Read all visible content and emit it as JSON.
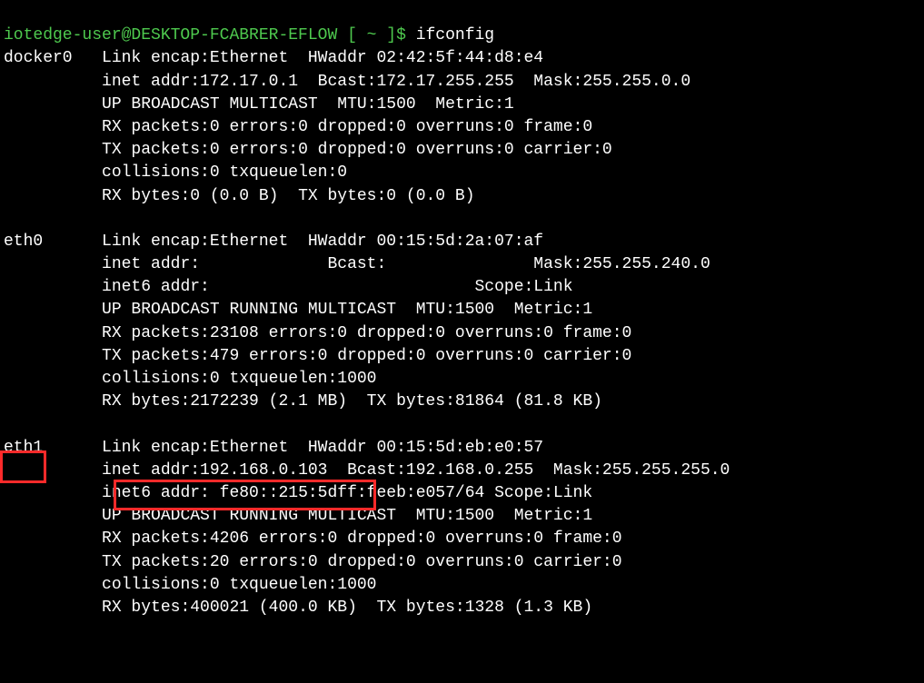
{
  "prompt": {
    "user_host": "iotedge-user@DESKTOP-FCABRER-EFLOW",
    "path_segment": " [ ~ ]$ ",
    "command": "ifconfig"
  },
  "interfaces": {
    "docker0": {
      "name": "docker0",
      "l1": "Link encap:Ethernet  HWaddr 02:42:5f:44:d8:e4",
      "l2": "inet addr:172.17.0.1  Bcast:172.17.255.255  Mask:255.255.0.0",
      "l3": "UP BROADCAST MULTICAST  MTU:1500  Metric:1",
      "l4": "RX packets:0 errors:0 dropped:0 overruns:0 frame:0",
      "l5": "TX packets:0 errors:0 dropped:0 overruns:0 carrier:0",
      "l6": "collisions:0 txqueuelen:0",
      "l7": "RX bytes:0 (0.0 B)  TX bytes:0 (0.0 B)"
    },
    "eth0": {
      "name": "eth0",
      "l1": "Link encap:Ethernet  HWaddr 00:15:5d:2a:07:af",
      "l2": "inet addr:             Bcast:               Mask:255.255.240.0",
      "l3": "inet6 addr:                           Scope:Link",
      "l4": "UP BROADCAST RUNNING MULTICAST  MTU:1500  Metric:1",
      "l5": "RX packets:23108 errors:0 dropped:0 overruns:0 frame:0",
      "l6": "TX packets:479 errors:0 dropped:0 overruns:0 carrier:0",
      "l7": "collisions:0 txqueuelen:1000",
      "l8": "RX bytes:2172239 (2.1 MB)  TX bytes:81864 (81.8 KB)"
    },
    "eth1": {
      "name": "eth1",
      "l1": "Link encap:Ethernet  HWaddr 00:15:5d:eb:e0:57",
      "l2": "inet addr:192.168.0.103  Bcast:192.168.0.255  Mask:255.255.255.0",
      "l3": "inet6 addr: fe80::215:5dff:feeb:e057/64 Scope:Link",
      "l4": "UP BROADCAST RUNNING MULTICAST  MTU:1500  Metric:1",
      "l5": "RX packets:4206 errors:0 dropped:0 overruns:0 frame:0",
      "l6": "TX packets:20 errors:0 dropped:0 overruns:0 carrier:0",
      "l7": "collisions:0 txqueuelen:1000",
      "l8": "RX bytes:400021 (400.0 KB)  TX bytes:1328 (1.3 KB)"
    }
  },
  "highlights": {
    "eth1_name_color": "#ff2a2a",
    "eth1_inet_color": "#ff2a2a"
  }
}
